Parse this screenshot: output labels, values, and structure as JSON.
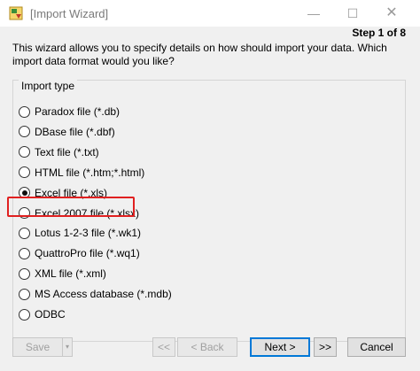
{
  "window": {
    "title": "[Import Wizard]",
    "minimize_glyph": "—",
    "maximize_glyph": "☐",
    "close_glyph": "✕"
  },
  "step": "Step 1 of 8",
  "intro": "This wizard allows you to specify details on how should import your data. Which import data format would you like?",
  "import_type": {
    "label": "Import type",
    "options": [
      {
        "label": "Paradox file (*.db)",
        "checked": false
      },
      {
        "label": "DBase file (*.dbf)",
        "checked": false
      },
      {
        "label": "Text file (*.txt)",
        "checked": false
      },
      {
        "label": "HTML file (*.htm;*.html)",
        "checked": false
      },
      {
        "label": "Excel file (*.xls)",
        "checked": true
      },
      {
        "label": "Excel 2007 file (*.xlsx)",
        "checked": false
      },
      {
        "label": "Lotus 1-2-3 file (*.wk1)",
        "checked": false
      },
      {
        "label": "QuattroPro file (*.wq1)",
        "checked": false
      },
      {
        "label": "XML file (*.xml)",
        "checked": false
      },
      {
        "label": "MS Access database (*.mdb)",
        "checked": false
      },
      {
        "label": "ODBC",
        "checked": false
      }
    ]
  },
  "buttons": {
    "save": "Save",
    "save_dropdown": "▾",
    "first": "<<",
    "back": "< Back",
    "next": "Next >",
    "last": ">>",
    "cancel": "Cancel"
  },
  "colors": {
    "highlight": "#e02020",
    "default_button_border": "#0078d7"
  }
}
